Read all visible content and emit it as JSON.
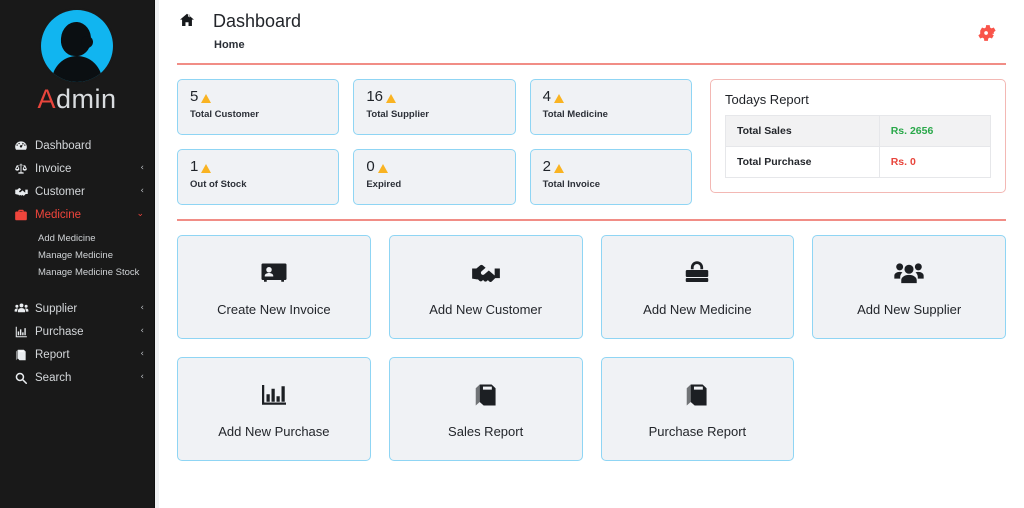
{
  "sidebar": {
    "brand": {
      "accent_letter": "A",
      "rest": "dmin",
      "avatar_icon": "user-silhouette-avatar"
    },
    "accent_color": "#f0453c",
    "items": [
      {
        "label": "Dashboard",
        "icon": "tachometer-icon",
        "caret": "",
        "active": false
      },
      {
        "label": "Invoice",
        "icon": "balance-scale-icon",
        "caret": "‹",
        "active": false
      },
      {
        "label": "Customer",
        "icon": "handshake-icon",
        "caret": "‹",
        "active": false
      },
      {
        "label": "Medicine",
        "icon": "briefcase-medical-icon",
        "caret": "⌄",
        "active": true
      },
      {
        "label": "Supplier",
        "icon": "users-group-icon",
        "caret": "‹",
        "active": false
      },
      {
        "label": "Purchase",
        "icon": "chart-bar-icon",
        "caret": "‹",
        "active": false
      },
      {
        "label": "Report",
        "icon": "book-icon",
        "caret": "‹",
        "active": false
      },
      {
        "label": "Search",
        "icon": "search-icon",
        "caret": "‹",
        "active": false
      }
    ],
    "submenu": [
      "Add Medicine",
      "Manage Medicine",
      "Manage Medicine Stock"
    ]
  },
  "header": {
    "home_icon": "home-icon",
    "title": "Dashboard",
    "breadcrumb": "Home",
    "settings_icon": "gear-icon",
    "settings_color": "#f9544a"
  },
  "stats": [
    {
      "value": "5",
      "label": "Total Customer"
    },
    {
      "value": "16",
      "label": "Total Supplier"
    },
    {
      "value": "4",
      "label": "Total Medicine"
    },
    {
      "value": "1",
      "label": "Out of Stock"
    },
    {
      "value": "0",
      "label": "Expired"
    },
    {
      "value": "2",
      "label": "Total Invoice"
    }
  ],
  "report": {
    "title": "Todays Report",
    "rows": [
      {
        "key": "Total Sales",
        "value": "Rs. 2656",
        "value_color": "#2aa84a"
      },
      {
        "key": "Total Purchase",
        "value": "Rs. 0",
        "value_color": "#e8453c"
      }
    ]
  },
  "tiles": [
    {
      "label": "Create New Invoice",
      "icon": "id-card-icon"
    },
    {
      "label": "Add New Customer",
      "icon": "handshake-icon"
    },
    {
      "label": "Add New Medicine",
      "icon": "medical-bag-icon"
    },
    {
      "label": "Add New Supplier",
      "icon": "users-group-icon"
    },
    {
      "label": "Add New Purchase",
      "icon": "chart-bar-icon"
    },
    {
      "label": "Sales Report",
      "icon": "book-icon"
    },
    {
      "label": "Purchase Report",
      "icon": "book-icon"
    }
  ]
}
